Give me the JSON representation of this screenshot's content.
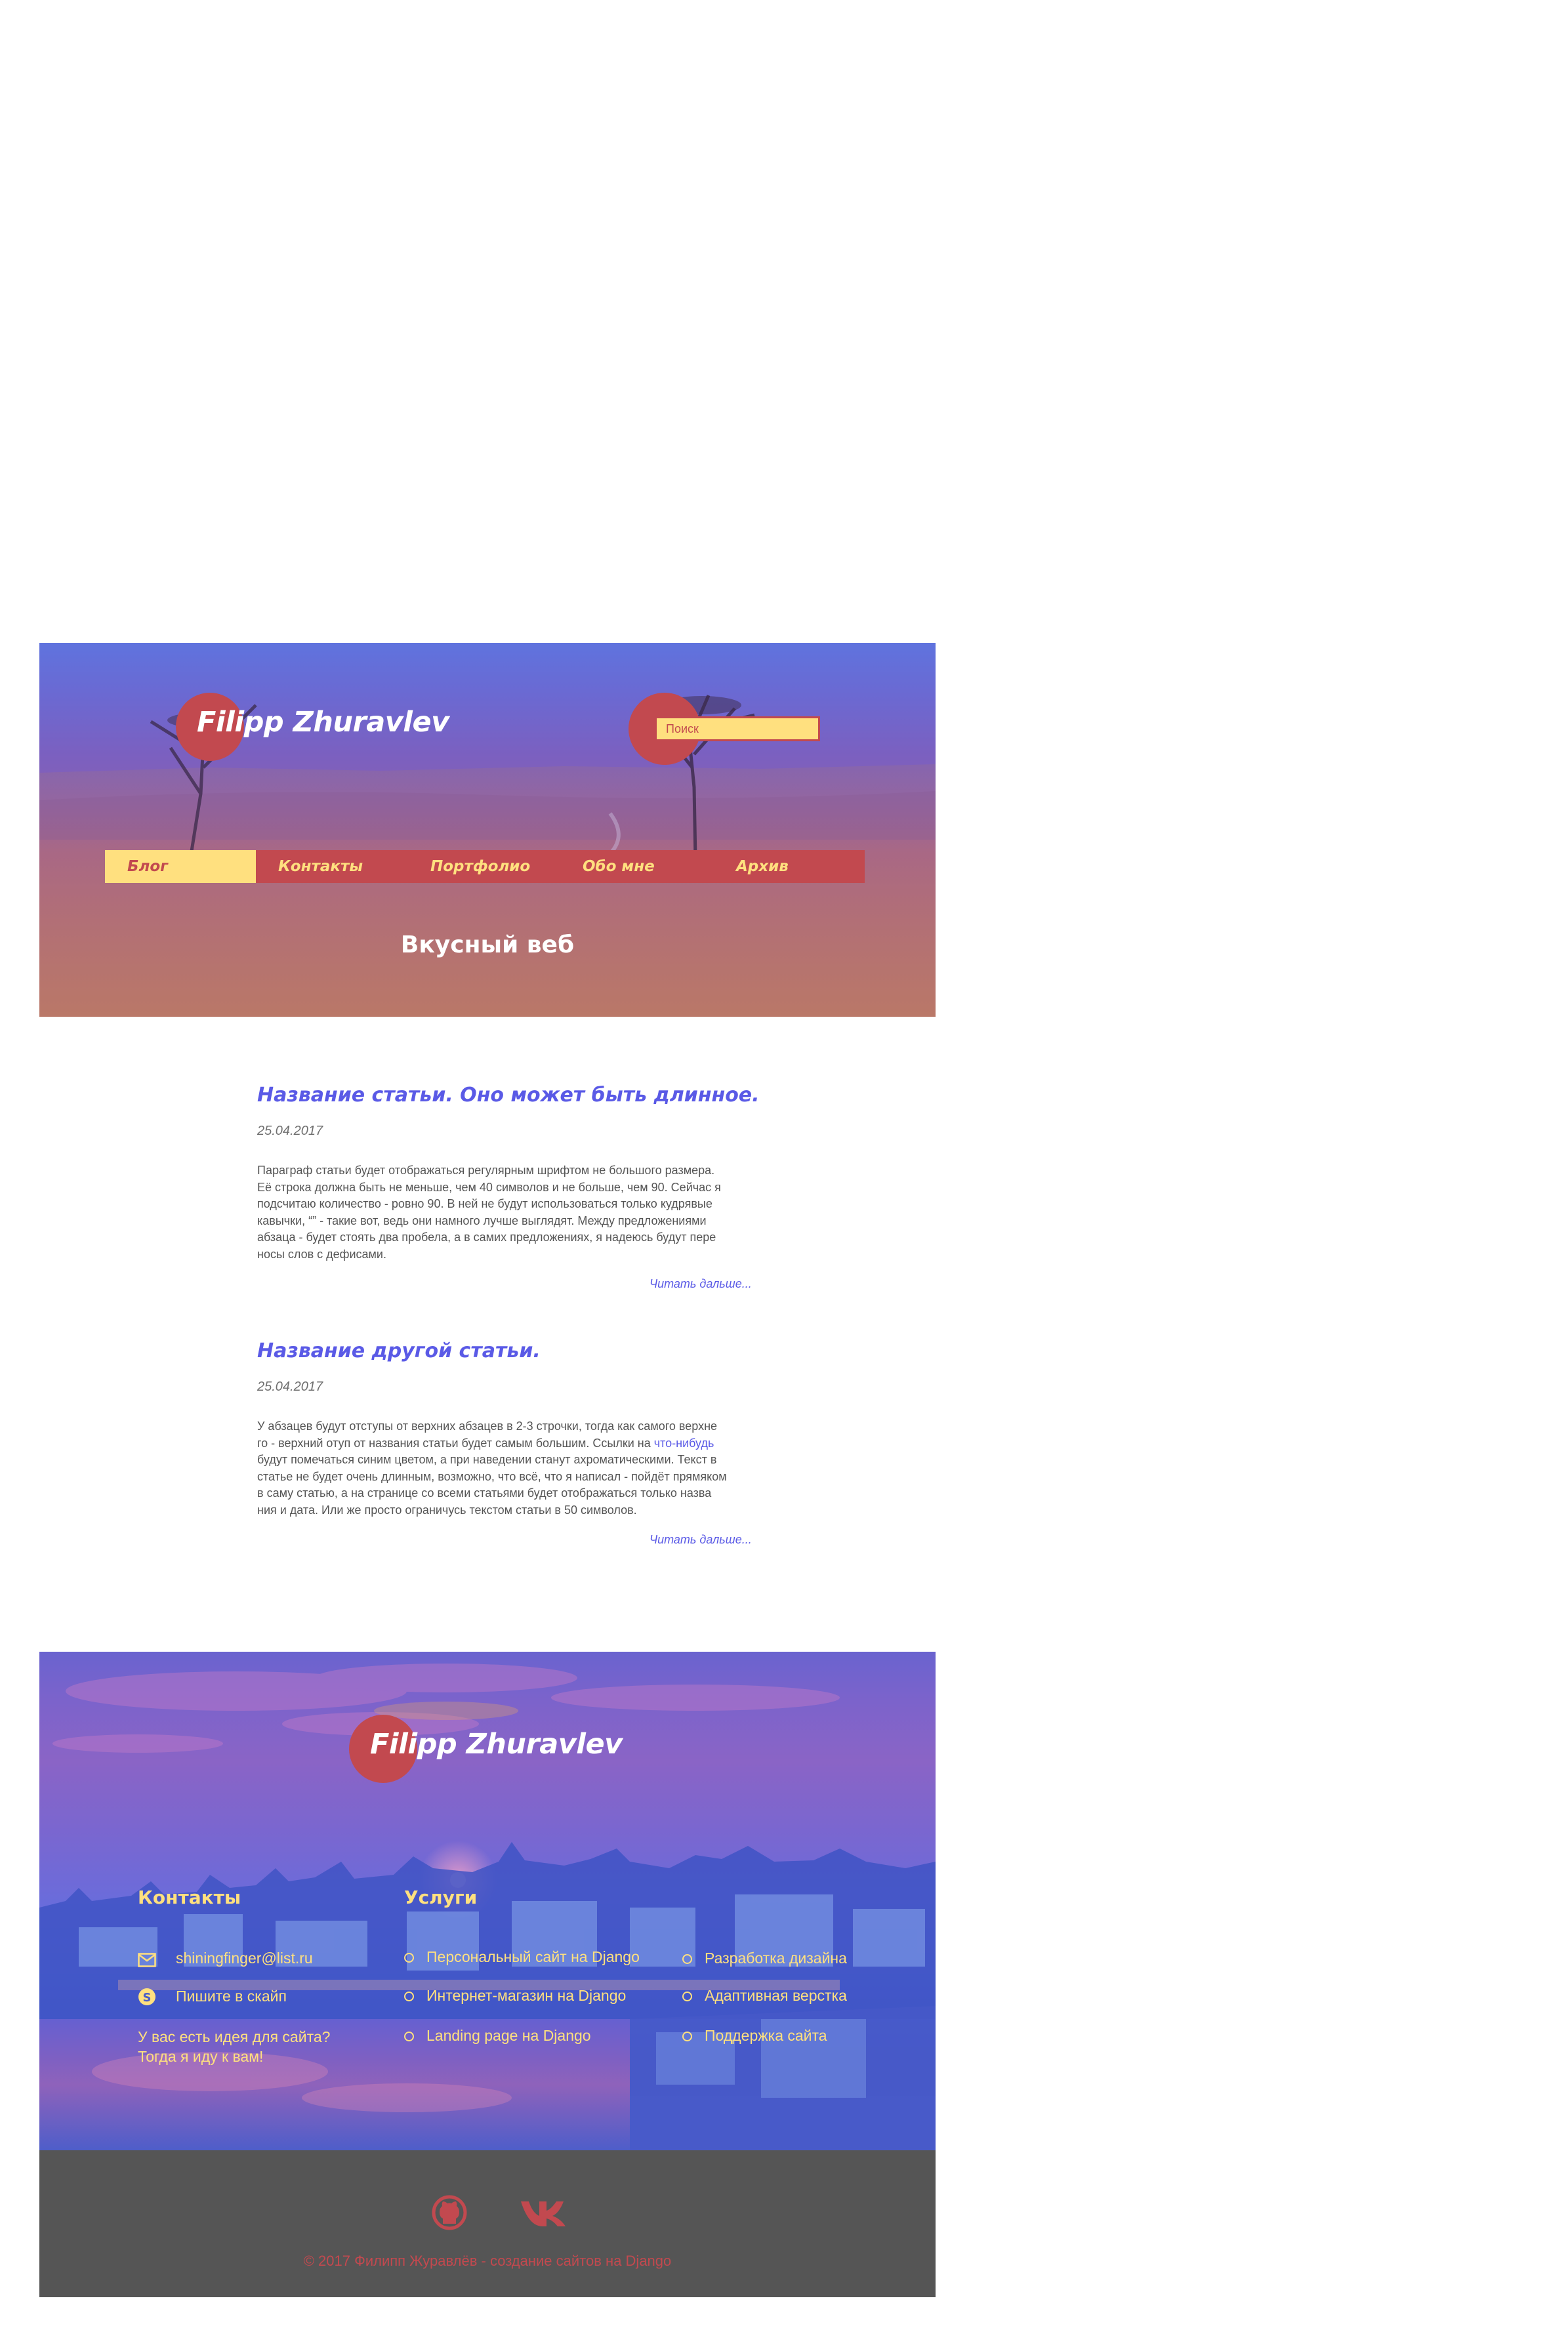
{
  "colors": {
    "accent_red": "#c2494f",
    "accent_yellow": "#ffe07f",
    "link_blue": "#5a5ae6",
    "footer_dark": "#555555"
  },
  "header": {
    "logo_text": "Filipp Zhuravlev",
    "search_placeholder": "Поиск",
    "nav": [
      {
        "label": "Блог",
        "active": true
      },
      {
        "label": "Контакты",
        "active": false
      },
      {
        "label": "Портфолио",
        "active": false
      },
      {
        "label": "Обо мне",
        "active": false
      },
      {
        "label": "Архив",
        "active": false
      }
    ],
    "tagline": "Вкусный веб"
  },
  "articles": [
    {
      "title": "Название статьи.  Оно может быть длинное.",
      "date": "25.04.2017",
      "lines": [
        "Параграф статьи будет отображаться регулярным шрифтом не большого размера.",
        "Её строка должна быть не меньше, чем 40 символов и не больше, чем 90. Сейчас я",
        "подсчитаю количество - ровно 90.  В ней не будут использоваться только кудрявые",
        "кавычки, “” - такие вот, ведь они намного лучше выглядят.  Между предложениями",
        "абзаца - будет стоять два пробела, а в самих предложениях, я надеюсь будут пере",
        "носы слов с дефисами."
      ],
      "read_more": "Читать дальше..."
    },
    {
      "title": "Название  другой статьи.",
      "date": "25.04.2017",
      "lines": [
        "У абзацев будут отступы от верхних абзацев в 2-3 строчки, тогда как самого верхне",
        "го - верхний отуп от названия статьи будет самым большим.  Ссылки на ",
        "будут помечаться синим цветом, а при наведении станут ахроматическими.  Текст в",
        "статье не будет очень длинным, возможно, что всё, что я написал - пойдёт прямяком",
        "в саму статью, а на странице  со всеми статьями будет отображаться только назва",
        "ния и дата.  Или же просто ограничусь текстом статьи в 50 символов."
      ],
      "inline_link": "что-нибудь",
      "read_more": "Читать дальше..."
    }
  ],
  "footer": {
    "logo_text": "Filipp Zhuravlev",
    "contacts_heading": "Контакты",
    "services_heading": "Услуги",
    "email": "shiningfinger@list.ru",
    "skype": "Пишите в скайп",
    "idea_line1": "У вас есть идея для сайта?",
    "idea_line2": "Тогда я иду к вам!",
    "services_col1": [
      "Персональный сайт на Django",
      "Интернет-магазин на Django",
      "Landing page на Django"
    ],
    "services_col2": [
      "Разработка дизайна",
      "Адаптивная верстка",
      "Поддержка сайта"
    ],
    "icons": {
      "email": "envelope-icon",
      "skype": "skype-icon",
      "github": "github-icon",
      "vk": "vk-icon"
    },
    "copyright": "© 2017 Филипп Журавлёв - создание сайтов на Django"
  }
}
